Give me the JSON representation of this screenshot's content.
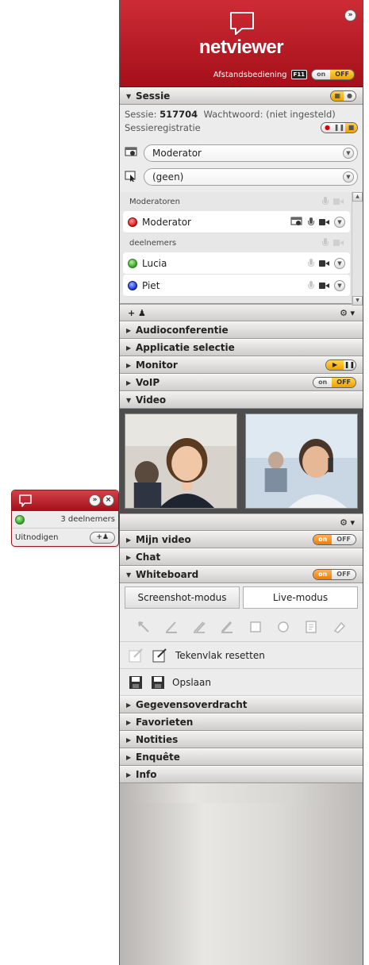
{
  "mini_window": {
    "participants_label": "3 deelnemers",
    "invite_label": "Uitnodigen",
    "invite_button": "+",
    "close_btn": "×",
    "expand_btn": "»"
  },
  "brand": {
    "name": "netviewer",
    "close_btn": "»",
    "remote_label": "Afstandsbediening",
    "remote_key": "F11",
    "toggle_on": "on",
    "toggle_off": "OFF"
  },
  "sessie": {
    "title": "Sessie",
    "session_label": "Sessie:",
    "session_id": "517704",
    "password_label": "Wachtwoord: (niet ingesteld)",
    "recording_label": "Sessieregistratie",
    "presenter_value": "Moderator",
    "control_value": "(geen)",
    "groups": {
      "moderators": "Moderatoren",
      "participants": "deelnemers"
    },
    "moderator_row": {
      "name": "Moderator",
      "status_color": "#d41414"
    },
    "participants": [
      {
        "name": "Lucia",
        "status_color": "#2aa118"
      },
      {
        "name": "Piet",
        "status_color": "#1530d8"
      }
    ],
    "add_button": "+"
  },
  "sections": {
    "audioconferentie": "Audioconferentie",
    "applicatie": "Applicatie selectie",
    "monitor": "Monitor",
    "voip": "VoIP",
    "video": "Video",
    "mijn_video": "Mijn video",
    "chat": "Chat",
    "whiteboard": "Whiteboard",
    "gegevens": "Gegevensoverdracht",
    "favorieten": "Favorieten",
    "notities": "Notities",
    "enquete": "Enquête",
    "info": "Info"
  },
  "toggles": {
    "on": "on",
    "off": "OFF"
  },
  "whiteboard": {
    "tab_screenshot": "Screenshot-modus",
    "tab_live": "Live-modus",
    "reset_label": "Tekenvlak resetten",
    "save_label": "Opslaan"
  },
  "colors": {
    "brand_red": "#b8161f",
    "toggle_yellow": "#f0a000",
    "toggle_orange": "#f07c00"
  }
}
